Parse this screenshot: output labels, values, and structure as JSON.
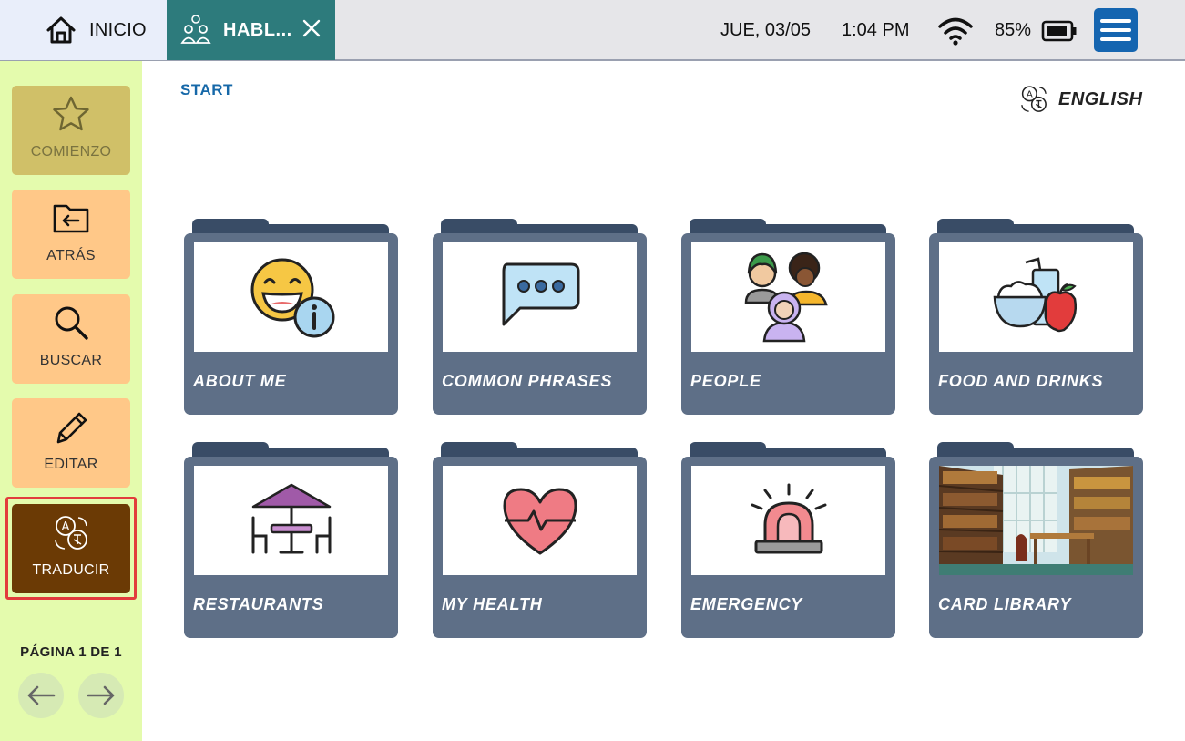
{
  "topbar": {
    "home_label": "INICIO",
    "active_tab_label": "HABL...",
    "date": "JUE, 03/05",
    "time": "1:04 PM",
    "battery": "85%"
  },
  "sidebar": {
    "start_label": "COMIENZO",
    "back_label": "ATRÁS",
    "search_label": "BUSCAR",
    "edit_label": "EDITAR",
    "translate_label": "TRADUCIR",
    "page_info": "PÁGINA 1 DE 1"
  },
  "main": {
    "breadcrumb": "START",
    "language": "ENGLISH",
    "folders": [
      {
        "label": "ABOUT ME",
        "icon": "smiley-info-icon"
      },
      {
        "label": "COMMON PHRASES",
        "icon": "speech-bubble-icon"
      },
      {
        "label": "PEOPLE",
        "icon": "people-icon"
      },
      {
        "label": "FOOD AND DRINKS",
        "icon": "food-drink-icon"
      },
      {
        "label": "RESTAURANTS",
        "icon": "restaurant-table-icon"
      },
      {
        "label": "MY HEALTH",
        "icon": "heart-pulse-icon"
      },
      {
        "label": "EMERGENCY",
        "icon": "siren-icon"
      },
      {
        "label": "CARD LIBRARY",
        "icon": "library-photo"
      }
    ]
  },
  "colors": {
    "active_tab": "#2d7b7c",
    "menu_button": "#1565b0",
    "sidebar_bg": "#e4fbad",
    "sidebar_button": "#ffc888",
    "start_button": "#d0c068",
    "translate_button": "#6b3a05",
    "folder_body": "#5e6f87",
    "folder_tab": "#394c66",
    "breadcrumb": "#1668a8"
  }
}
